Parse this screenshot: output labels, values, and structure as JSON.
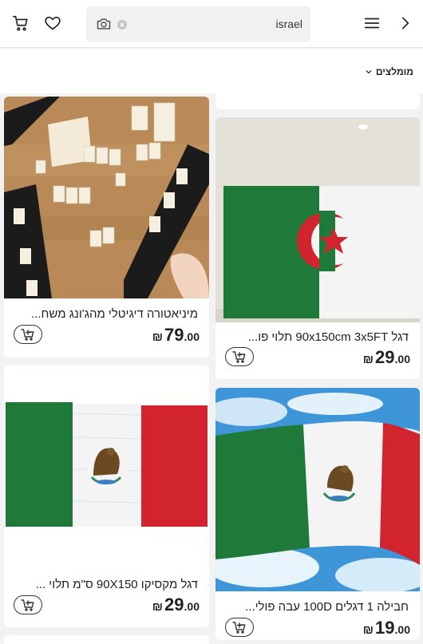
{
  "header": {
    "search_value": "israel",
    "icons": [
      "cart-icon",
      "heart-icon",
      "camera-icon",
      "clear-icon",
      "menu-icon",
      "chevron-right-icon"
    ]
  },
  "sort": {
    "label": "מומלצים"
  },
  "products": [
    {
      "title": "מיניאטורה דיגיטלי מהג'ונג משח...",
      "currency": "₪",
      "price_int": "79",
      "price_dec": ".00"
    },
    {
      "title": "דגל 90x150cm 3x5FT תלוי פו...",
      "currency": "₪",
      "price_int": "29",
      "price_dec": ".00"
    },
    {
      "title": "דגל מקסיקו 90X150 ס\"מ תלוי ...",
      "currency": "₪",
      "price_int": "29",
      "price_dec": ".00"
    },
    {
      "title": "חבילה 1 דגלים 100D עבה פולי...",
      "currency": "₪",
      "price_int": "19",
      "price_dec": ".00"
    }
  ],
  "colors": {
    "green": "#1f7a3a",
    "red": "#d1242f",
    "white": "#f4f4f4"
  }
}
